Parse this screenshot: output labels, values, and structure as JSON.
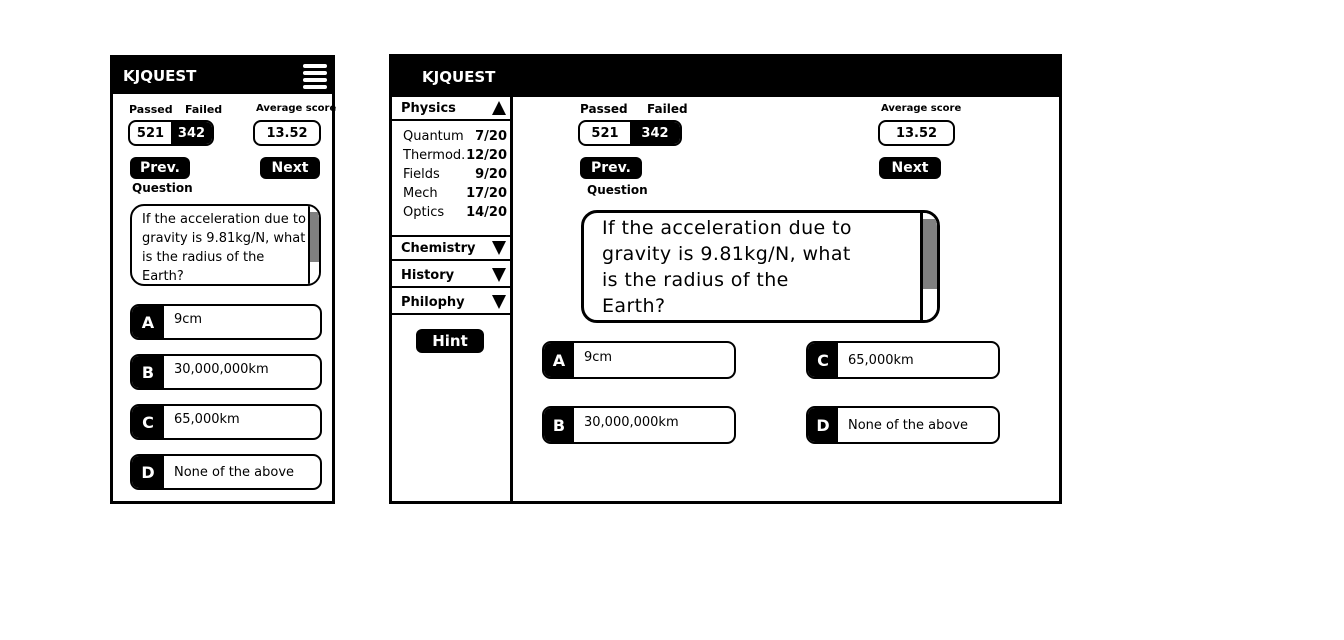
{
  "app": {
    "title": "KJQUEST"
  },
  "stats": {
    "passed_label": "Passed",
    "failed_label": "Failed",
    "avg_label": "Average score",
    "passed": "521",
    "failed": "342",
    "avg": "13.52"
  },
  "nav": {
    "prev": "Prev.",
    "next": "Next",
    "question_label": "Question",
    "hint": "Hint"
  },
  "question": {
    "text_mobile": [
      "If the acceleration due to",
      "gravity is 9.81kg/N, what",
      "is the radius of the",
      "Earth?"
    ],
    "text_desktop": [
      "If the acceleration due to",
      "gravity is 9.81kg/N, what",
      "is the radius of the",
      "Earth?"
    ]
  },
  "answers": [
    {
      "letter": "A",
      "value": "9cm"
    },
    {
      "letter": "B",
      "value": "30,000,000km"
    },
    {
      "letter": "C",
      "value": "65,000km"
    },
    {
      "letter": "D",
      "value": "None of the above"
    }
  ],
  "sidebar": {
    "categories": [
      {
        "name": "Physics",
        "expanded": true,
        "subs": [
          {
            "name": "Quantum",
            "score": "7/20"
          },
          {
            "name": "Thermod.",
            "score": "12/20"
          },
          {
            "name": "Fields",
            "score": "9/20"
          },
          {
            "name": "Mech",
            "score": "17/20"
          },
          {
            "name": "Optics",
            "score": "14/20"
          }
        ]
      },
      {
        "name": "Chemistry",
        "expanded": false
      },
      {
        "name": "History",
        "expanded": false
      },
      {
        "name": "Philophy",
        "expanded": false
      }
    ]
  },
  "colors": {
    "dark": "#000000",
    "scrollbar_thumb": "#808080",
    "background": "#ffffff"
  }
}
